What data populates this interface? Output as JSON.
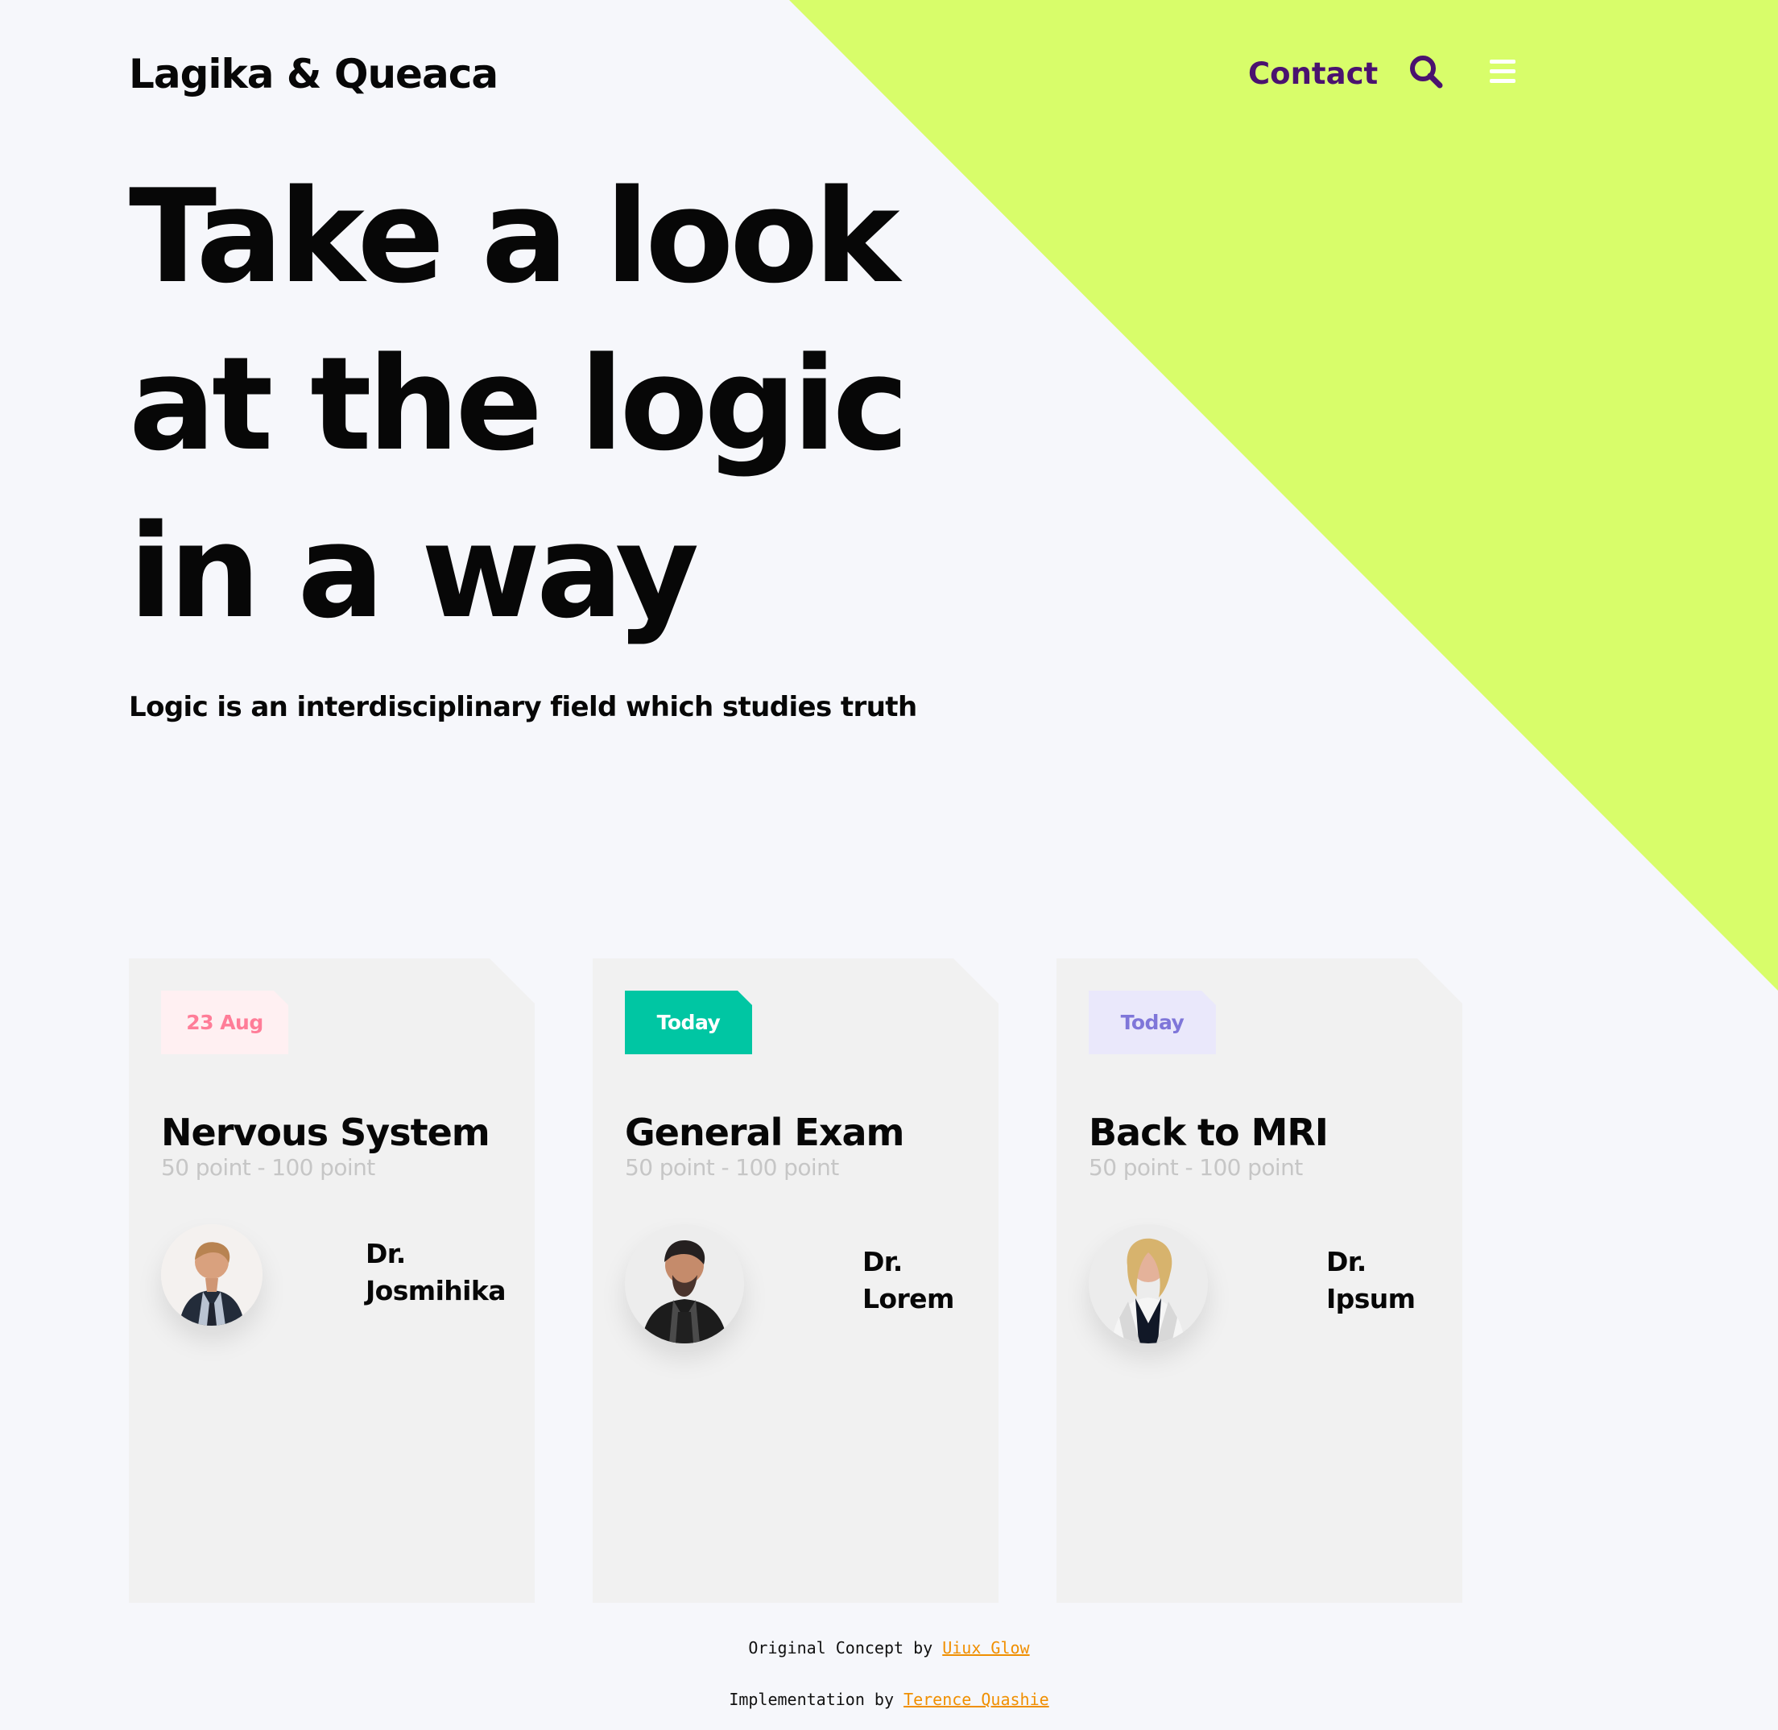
{
  "site": {
    "brand": "Lagika & Queaca"
  },
  "navigation": {
    "contact_label": "Contact",
    "search_icon": "search-icon",
    "menu_icon": "menu-icon"
  },
  "hero": {
    "title_lines": [
      "Take a look",
      "at the logic",
      "in a way"
    ],
    "subtitle": "Logic is an interdisciplinary field which studies truth"
  },
  "cards": [
    {
      "badge": "23 Aug",
      "badge_color": "#ff7d98",
      "badge_background": "#fff0f2",
      "title": "Nervous System",
      "points": "50 point - 100 point",
      "doctor_lines": [
        "Dr.",
        "Josmihika"
      ],
      "avatar_icon": "doctor-male-avatar"
    },
    {
      "badge": "Today",
      "badge_color": "#ffffff",
      "badge_background": "#00c6a3",
      "title": "General Exam",
      "points": "50 point - 100 point",
      "doctor_lines": [
        "Dr.",
        "Lorem"
      ],
      "avatar_icon": "doctor-male-avatar"
    },
    {
      "badge": "Today",
      "badge_color": "#7f76d9",
      "badge_background": "#eae8fb",
      "title": "Back to MRI",
      "points": "50 point - 100 point",
      "doctor_lines": [
        "Dr.",
        "Ipsum"
      ],
      "avatar_icon": "doctor-female-avatar"
    }
  ],
  "footer": {
    "concept_prefix": "Original Concept by ",
    "concept_name": "Uiux Glow",
    "implementation_prefix": "Implementation by ",
    "implementation_name": "Terence Quashie"
  },
  "colors": {
    "background": "#f6f7fb",
    "accent": "#d8fd6a",
    "primary_text": "#070707",
    "nav_accent": "#4a126f",
    "muted_text": "#c6c6c6",
    "credit_accent": "#f08f00"
  }
}
